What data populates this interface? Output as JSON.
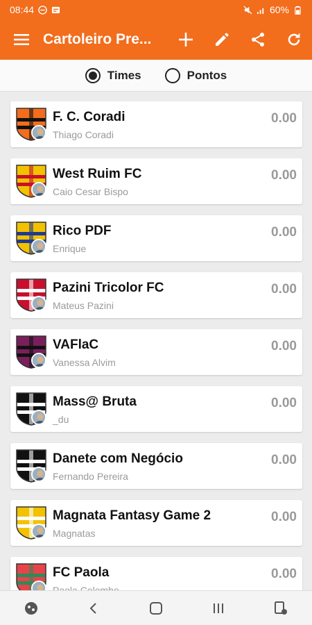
{
  "status": {
    "time": "08:44",
    "battery": "60%"
  },
  "toolbar": {
    "title": "Cartoleiro Pre...",
    "icons": [
      "menu-icon",
      "plus-icon",
      "pencil-icon",
      "share-icon",
      "refresh-icon"
    ]
  },
  "tabs": {
    "selected": "Times",
    "options": [
      "Times",
      "Pontos"
    ]
  },
  "teams": [
    {
      "name": "F. C. Coradi",
      "owner": "Thiago Coradi",
      "score": "0.00",
      "crest_colors": [
        "#f26d1c",
        "#111111"
      ]
    },
    {
      "name": "West Ruim FC",
      "owner": "Caio Cesar Bispo",
      "score": "0.00",
      "crest_colors": [
        "#f2c200",
        "#c8102e"
      ]
    },
    {
      "name": "Rico PDF",
      "owner": "Enrique",
      "score": "0.00",
      "crest_colors": [
        "#f2c200",
        "#1f3a93"
      ]
    },
    {
      "name": "Pazini Tricolor FC",
      "owner": "Mateus Pazini",
      "score": "0.00",
      "crest_colors": [
        "#c8102e",
        "#ffffff"
      ]
    },
    {
      "name": "VAFlaC",
      "owner": "Vanessa Alvim",
      "score": "0.00",
      "crest_colors": [
        "#7a1f5c",
        "#111111"
      ]
    },
    {
      "name": "Mass@ Bruta",
      "owner": "_du",
      "score": "0.00",
      "crest_colors": [
        "#111111",
        "#ffffff"
      ]
    },
    {
      "name": "Danete com Negócio",
      "owner": "Fernando Pereira",
      "score": "0.00",
      "crest_colors": [
        "#111111",
        "#ffffff"
      ]
    },
    {
      "name": "Magnata Fantasy Game 2",
      "owner": "Magnatas",
      "score": "0.00",
      "crest_colors": [
        "#f2c200",
        "#ffffff"
      ]
    },
    {
      "name": "FC Paola",
      "owner": "Paola Colombo",
      "score": "0.00",
      "crest_colors": [
        "#e8434a",
        "#2e8b57"
      ]
    }
  ],
  "navbar": {
    "icons": [
      "game-icon",
      "back-icon",
      "home-icon",
      "recents-icon",
      "screenshot-icon"
    ]
  },
  "colors": {
    "accent": "#f26d1c",
    "muted": "#9a9a9a"
  }
}
